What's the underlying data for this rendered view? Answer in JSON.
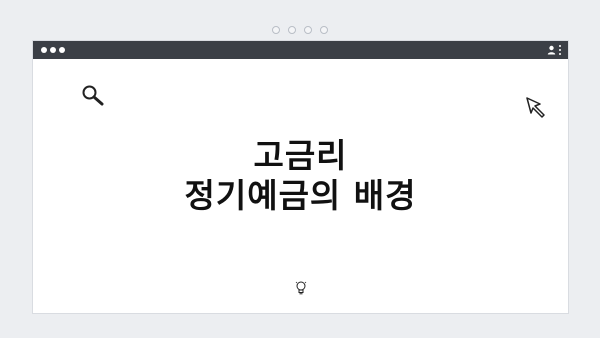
{
  "page": {
    "headline_line1": "고금리",
    "headline_line2": "정기예금의 배경"
  },
  "icons": {
    "search": "search-icon",
    "cursor": "cursor-arrow-icon",
    "idea": "lightbulb-icon",
    "user": "user-icon",
    "menu": "kebab-menu-icon"
  },
  "colors": {
    "titlebar": "#3b3f46",
    "background": "#eceef1",
    "canvas": "#ffffff",
    "text": "#111111"
  }
}
